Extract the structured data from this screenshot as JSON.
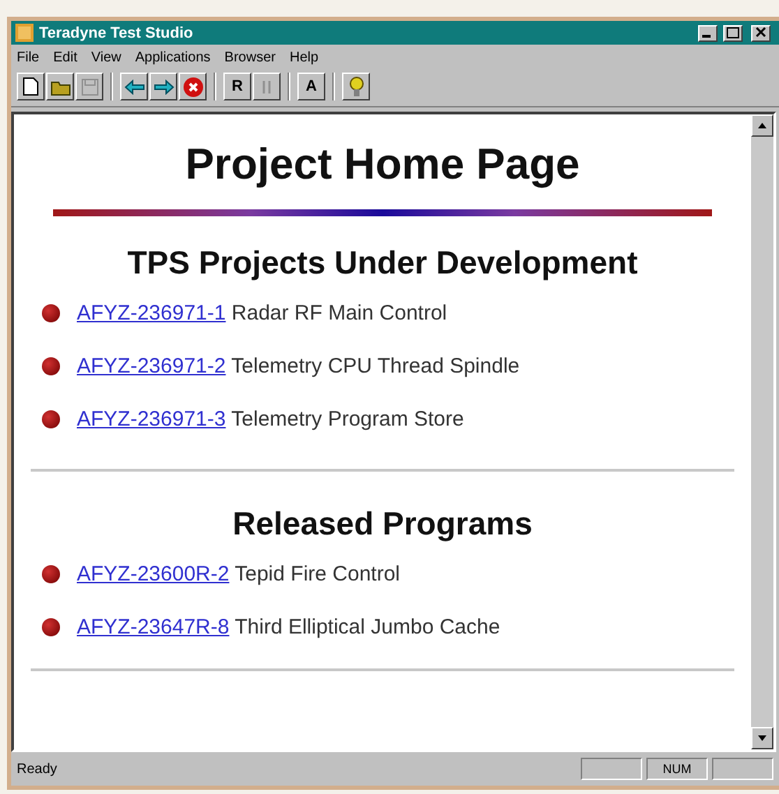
{
  "window": {
    "title": "Teradyne Test Studio"
  },
  "menu": [
    "File",
    "Edit",
    "View",
    "Applications",
    "Browser",
    "Help"
  ],
  "toolbar": [
    {
      "kind": "new",
      "disabled": false
    },
    {
      "kind": "open",
      "disabled": false
    },
    {
      "kind": "save",
      "disabled": true
    },
    {
      "kind": "sep"
    },
    {
      "kind": "back",
      "disabled": false
    },
    {
      "kind": "forward",
      "disabled": false
    },
    {
      "kind": "stop",
      "disabled": false
    },
    {
      "kind": "sep"
    },
    {
      "kind": "text",
      "label": "R",
      "disabled": false
    },
    {
      "kind": "pause",
      "disabled": true
    },
    {
      "kind": "sep"
    },
    {
      "kind": "text",
      "label": "A",
      "disabled": false
    },
    {
      "kind": "sep"
    },
    {
      "kind": "help",
      "disabled": false
    }
  ],
  "page": {
    "title": "Project Home Page",
    "sections": [
      {
        "heading": "TPS Projects Under Development",
        "items": [
          {
            "link": "AFYZ-236971-1",
            "text": "Radar RF Main Control"
          },
          {
            "link": "AFYZ-236971-2",
            "text": "Telemetry CPU Thread Spindle"
          },
          {
            "link": "AFYZ-236971-3",
            "text": "Telemetry Program Store"
          }
        ]
      },
      {
        "heading": "Released Programs",
        "items": [
          {
            "link": "AFYZ-23600R-2",
            "text": "Tepid Fire Control"
          },
          {
            "link": "AFYZ-23647R-8",
            "text": "Third Elliptical Jumbo Cache"
          }
        ]
      }
    ]
  },
  "status_bar": {
    "message": "Ready",
    "panels": [
      {
        "kind": "blank"
      },
      {
        "kind": "text",
        "text": "NUM"
      },
      {
        "kind": "blank"
      }
    ]
  }
}
